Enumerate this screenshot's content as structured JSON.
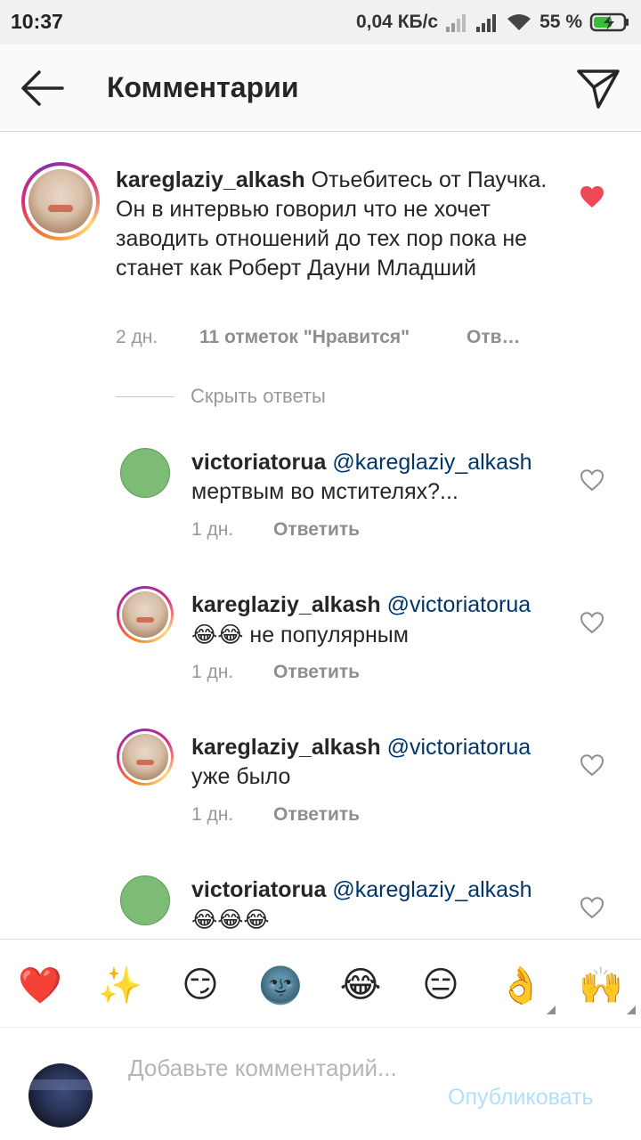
{
  "status_bar": {
    "time": "10:37",
    "net_speed": "0,04 КБ/с",
    "battery": "55 %"
  },
  "header": {
    "title": "Комментарии",
    "back_icon": "arrow-left-icon",
    "send_icon": "paper-plane-icon"
  },
  "main_comment": {
    "username": "kareglaziy_alkash",
    "text": "Отьебитесь от Паучка. Он в интервью говорил что не хочет заводить отношений до тех пор пока не станет как Роберт Дауни Младший",
    "time": "2 дн.",
    "likes": "11 отметок \"Нравится\"",
    "reply_label": "Отв…",
    "liked": true
  },
  "hide_replies": "Скрыть ответы",
  "replies": [
    {
      "username": "victoriatorua",
      "mention": "@kareglaziy_alkash",
      "text": "мертвым во мстителях?...",
      "time": "1 дн.",
      "reply_label": "Ответить"
    },
    {
      "username": "kareglaziy_alkash",
      "mention": "@victoriatorua",
      "emoji": "😂😂",
      "text": " не популярным",
      "time": "1 дн.",
      "reply_label": "Ответить"
    },
    {
      "username": "kareglaziy_alkash",
      "mention": "@victoriatorua",
      "text": "уже было",
      "time": "1 дн.",
      "reply_label": "Ответить"
    },
    {
      "username": "victoriatorua",
      "mention": "@kareglaziy_alkash",
      "emoji": "😂😂😂"
    }
  ],
  "emoji_bar": [
    "❤️",
    "✨",
    "😏",
    "🌚",
    "😂",
    "😑",
    "👌",
    "🙌"
  ],
  "composer": {
    "placeholder": "Добавьте комментарий...",
    "publish": "Опубликовать"
  },
  "colors": {
    "like_red": "#ed4956",
    "mention_blue": "#003569",
    "publish_disabled": "#b2dffc"
  }
}
